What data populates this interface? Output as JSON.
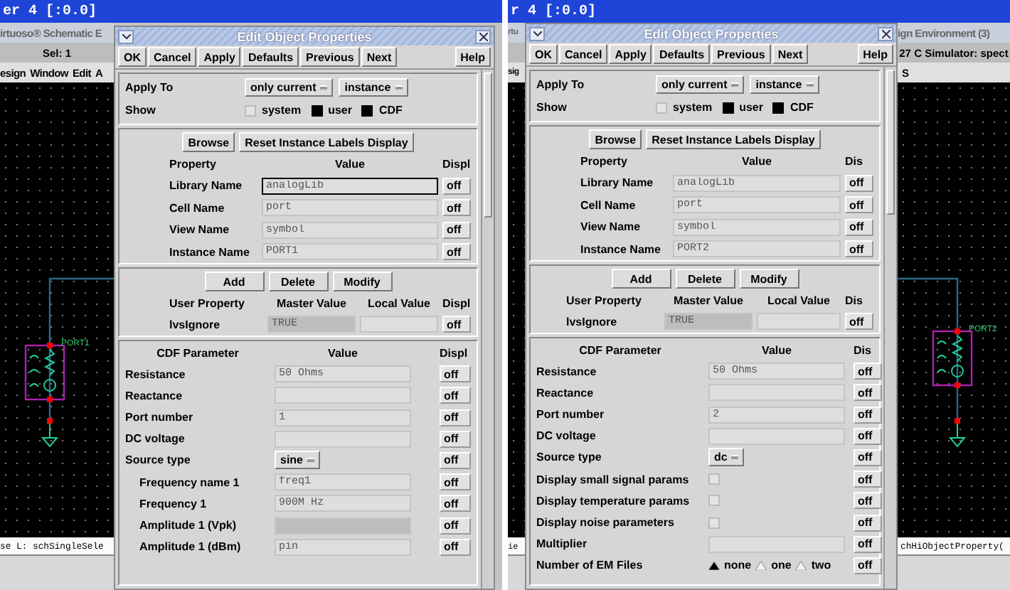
{
  "panels": [
    {
      "title_bar": "er 4 [:0.0]",
      "left_window": {
        "title": "irtuoso® Schematic E",
        "toolbar_text": "Sel: 1",
        "menu": [
          "esign",
          "Window",
          "Edit",
          "A"
        ],
        "status": "se L: schSingleSele",
        "instance_label": "PORT1"
      },
      "dialog": {
        "title": "Edit Object Properties",
        "buttons": [
          "OK",
          "Cancel",
          "Apply",
          "Defaults",
          "Previous",
          "Next"
        ],
        "help_button": "Help",
        "apply_to": {
          "label": "Apply To",
          "options": [
            "only current",
            "instance"
          ]
        },
        "show": {
          "label": "Show",
          "options": [
            {
              "label": "system",
              "checked": false
            },
            {
              "label": "user",
              "checked": true
            },
            {
              "label": "CDF",
              "checked": true
            }
          ]
        },
        "property_buttons": [
          "Browse",
          "Reset Instance Labels Display"
        ],
        "property_header": [
          "Property",
          "Value",
          "Displ"
        ],
        "properties": [
          {
            "name": "Library Name",
            "value": "analogLib",
            "display": "off",
            "focused": true
          },
          {
            "name": "Cell Name",
            "value": "port",
            "display": "off",
            "focused": false
          },
          {
            "name": "View Name",
            "value": "symbol",
            "display": "off",
            "focused": false
          },
          {
            "name": "Instance Name",
            "value": "PORT1",
            "display": "off",
            "focused": false
          }
        ],
        "user_buttons": [
          "Add",
          "Delete",
          "Modify"
        ],
        "user_header": [
          "User Property",
          "Master Value",
          "Local Value",
          "Displ"
        ],
        "user_properties": [
          {
            "name": "lvsIgnore",
            "master_value": "TRUE",
            "display": "off"
          }
        ],
        "cdf_header": [
          "CDF Parameter",
          "Value",
          "Displ"
        ],
        "cdf_parameters": [
          {
            "kind": "field",
            "name": "Resistance",
            "value": "50 Ohms",
            "display": "off"
          },
          {
            "kind": "field",
            "name": "Reactance",
            "display": "off"
          },
          {
            "kind": "field",
            "name": "Port number",
            "value": "1",
            "display": "off"
          },
          {
            "kind": "field",
            "name": "DC voltage",
            "display": "off"
          },
          {
            "kind": "select",
            "name": "Source type",
            "value": "sine",
            "display": "off",
            "children": [
              {
                "kind": "field",
                "name": "Frequency name 1",
                "value": "freq1",
                "display": "off"
              },
              {
                "kind": "field",
                "name": "Frequency 1",
                "value": "900M Hz",
                "display": "off"
              },
              {
                "kind": "field",
                "name": "Amplitude 1 (Vpk)",
                "disabled": true,
                "display": "off"
              },
              {
                "kind": "field",
                "name": "Amplitude 1 (dBm)",
                "value": "pin",
                "display": "off"
              }
            ]
          }
        ]
      }
    },
    {
      "title_bar": "r 4 [:0.0]",
      "left_window": {
        "title": "rtu",
        "menu": [
          "sig"
        ],
        "status": "ie"
      },
      "right_window": {
        "title": "ign Environment (3)",
        "toolbar_text": "27 C  Simulator: spect",
        "menu": [
          "S"
        ],
        "status": "chHiObjectProperty(",
        "instance_label": "PORT2"
      },
      "dialog": {
        "title": "Edit Object Properties",
        "buttons": [
          "OK",
          "Cancel",
          "Apply",
          "Defaults",
          "Previous",
          "Next"
        ],
        "help_button": "Help",
        "apply_to": {
          "label": "Apply To",
          "options": [
            "only current",
            "instance"
          ]
        },
        "show": {
          "label": "Show",
          "options": [
            {
              "label": "system",
              "checked": false
            },
            {
              "label": "user",
              "checked": true
            },
            {
              "label": "CDF",
              "checked": true
            }
          ]
        },
        "property_buttons": [
          "Browse",
          "Reset Instance Labels Display"
        ],
        "property_header": [
          "Property",
          "Value",
          "Dis"
        ],
        "properties": [
          {
            "name": "Library Name",
            "value": "analogLib",
            "display": "off",
            "focused": false
          },
          {
            "name": "Cell Name",
            "value": "port",
            "display": "off",
            "focused": false
          },
          {
            "name": "View Name",
            "value": "symbol",
            "display": "off",
            "focused": false
          },
          {
            "name": "Instance Name",
            "value": "PORT2",
            "display": "off",
            "focused": false
          }
        ],
        "user_buttons": [
          "Add",
          "Delete",
          "Modify"
        ],
        "user_header": [
          "User Property",
          "Master Value",
          "Local Value",
          "Dis"
        ],
        "user_properties": [
          {
            "name": "lvsIgnore",
            "master_value": "TRUE",
            "display": "off"
          }
        ],
        "cdf_header": [
          "CDF Parameter",
          "Value",
          "Dis"
        ],
        "cdf_parameters": [
          {
            "kind": "field",
            "name": "Resistance",
            "value": "50 Ohms",
            "display": "off"
          },
          {
            "kind": "field",
            "name": "Reactance",
            "display": "off"
          },
          {
            "kind": "field",
            "name": "Port number",
            "value": "2",
            "display": "off"
          },
          {
            "kind": "field",
            "name": "DC voltage",
            "display": "off"
          },
          {
            "kind": "select",
            "name": "Source type",
            "value": "dc",
            "display": "off"
          },
          {
            "kind": "checkbox",
            "name": "Display small signal params",
            "checked": false,
            "display": "off"
          },
          {
            "kind": "checkbox",
            "name": "Display temperature params",
            "checked": false,
            "display": "off"
          },
          {
            "kind": "checkbox",
            "name": "Display noise parameters",
            "checked": false,
            "display": "off"
          },
          {
            "kind": "field",
            "name": "Multiplier",
            "display": "off"
          },
          {
            "kind": "radio",
            "name": "Number of EM Files",
            "options": [
              {
                "label": "none",
                "selected": true
              },
              {
                "label": "one",
                "selected": false
              },
              {
                "label": "two",
                "selected": false
              }
            ],
            "display": "off"
          }
        ]
      }
    }
  ]
}
